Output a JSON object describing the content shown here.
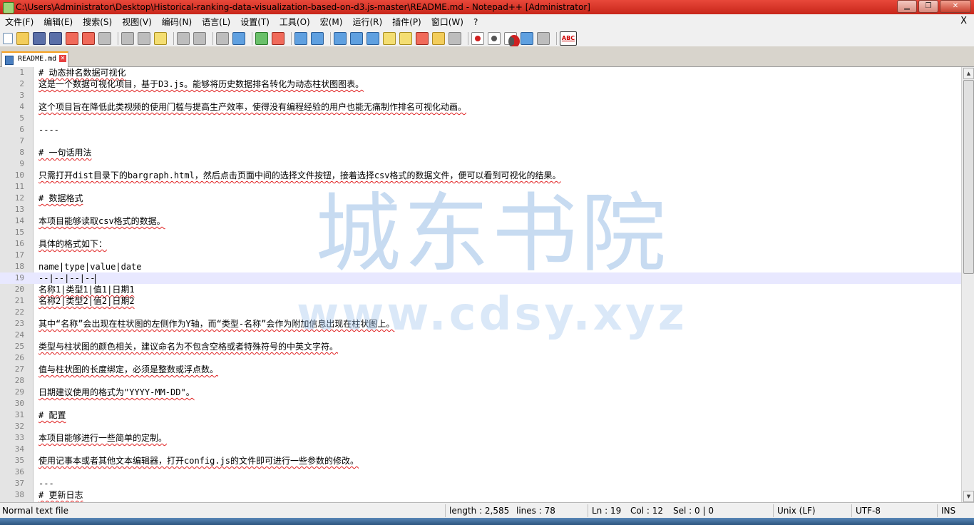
{
  "window": {
    "title": "C:\\Users\\Administrator\\Desktop\\Historical-ranking-data-visualization-based-on-d3.js-master\\README.md - Notepad++ [Administrator]",
    "minimize": "▁",
    "maximize": "❐",
    "close": "✕"
  },
  "menu": {
    "items": [
      "文件(F)",
      "编辑(E)",
      "搜索(S)",
      "视图(V)",
      "编码(N)",
      "语言(L)",
      "设置(T)",
      "工具(O)",
      "宏(M)",
      "运行(R)",
      "插件(P)",
      "窗口(W)",
      "?"
    ],
    "close_doc": "X"
  },
  "toolbar": {
    "spellcheck_label": "ABC"
  },
  "tabs": [
    {
      "label": "README.md",
      "close": "✕"
    }
  ],
  "editor": {
    "current_line": 19,
    "lines": [
      {
        "n": "1",
        "text": "# 动态排名数据可视化"
      },
      {
        "n": "2",
        "text": "这是一个数据可视化项目，基于D3.js。能够将历史数据排名转化为动态柱状图图表。"
      },
      {
        "n": "3",
        "text": ""
      },
      {
        "n": "4",
        "text": "这个项目旨在降低此类视频的使用门槛与提高生产效率，使得没有编程经验的用户也能无痛制作排名可视化动画。"
      },
      {
        "n": "5",
        "text": ""
      },
      {
        "n": "6",
        "text": "----"
      },
      {
        "n": "7",
        "text": ""
      },
      {
        "n": "8",
        "text": "# 一句话用法"
      },
      {
        "n": "9",
        "text": ""
      },
      {
        "n": "10",
        "text": "只需打开dist目录下的bargraph.html，然后点击页面中间的选择文件按钮，接着选择csv格式的数据文件，便可以看到可视化的结果。"
      },
      {
        "n": "11",
        "text": ""
      },
      {
        "n": "12",
        "text": "# 数据格式"
      },
      {
        "n": "13",
        "text": ""
      },
      {
        "n": "14",
        "text": "本项目能够读取csv格式的数据。"
      },
      {
        "n": "15",
        "text": ""
      },
      {
        "n": "16",
        "text": "具体的格式如下："
      },
      {
        "n": "17",
        "text": ""
      },
      {
        "n": "18",
        "text": "name|type|value|date"
      },
      {
        "n": "19",
        "text": "--|--|--|--"
      },
      {
        "n": "20",
        "text": "名称1|类型1|值1|日期1"
      },
      {
        "n": "21",
        "text": "名称2|类型2|值2|日期2"
      },
      {
        "n": "22",
        "text": ""
      },
      {
        "n": "23",
        "text": "其中“名称”会出现在柱状图的左侧作为Y轴，而“类型-名称”会作为附加信息出现在柱状图上。"
      },
      {
        "n": "24",
        "text": ""
      },
      {
        "n": "25",
        "text": "类型与柱状图的颜色相关，建议命名为不包含空格或者特殊符号的中英文字符。"
      },
      {
        "n": "26",
        "text": ""
      },
      {
        "n": "27",
        "text": "值与柱状图的长度绑定，必须是整数或浮点数。"
      },
      {
        "n": "28",
        "text": ""
      },
      {
        "n": "29",
        "text": "日期建议使用的格式为\"YYYY-MM-DD\"。"
      },
      {
        "n": "30",
        "text": ""
      },
      {
        "n": "31",
        "text": "# 配置"
      },
      {
        "n": "32",
        "text": ""
      },
      {
        "n": "33",
        "text": "本项目能够进行一些简单的定制。"
      },
      {
        "n": "34",
        "text": ""
      },
      {
        "n": "35",
        "text": "使用记事本或者其他文本编辑器，打开config.js的文件即可进行一些参数的修改。"
      },
      {
        "n": "36",
        "text": ""
      },
      {
        "n": "37",
        "text": "---"
      },
      {
        "n": "38",
        "text": "# 更新日志"
      }
    ]
  },
  "watermark": {
    "cn": "城东书院",
    "en": "www.cdsy.xyz"
  },
  "status": {
    "file_type": "Normal text file",
    "length": "length : 2,585",
    "lines": "lines : 78",
    "ln": "Ln : 19",
    "col": "Col : 12",
    "sel": "Sel : 0 | 0",
    "eol": "Unix (LF)",
    "encoding": "UTF-8",
    "mode": "INS"
  },
  "colors": {
    "titlebar": "#d83626",
    "current_line": "#e8e8ff",
    "gutter": "#e4e4e4",
    "spell_underline": "#e02020"
  }
}
